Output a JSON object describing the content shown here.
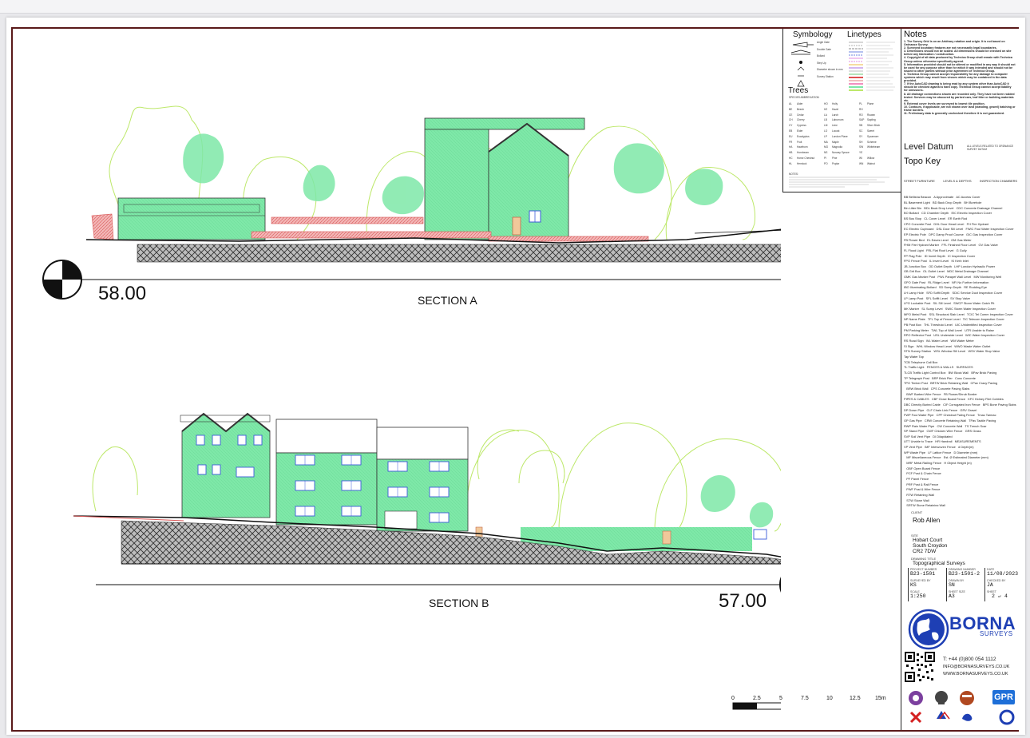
{
  "sheet": {
    "section_a": {
      "title": "SECTION A",
      "level": "58.00"
    },
    "section_b": {
      "title": "SECTION B",
      "level": "57.00"
    }
  },
  "legend": {
    "symbology_title": "Symbology",
    "linetypes_title": "Linetypes",
    "symbology_items": [
      "Angle Gate",
      "Double Gate",
      "Bollard",
      "Step Up",
      "Diameter shown in mm",
      "Survey Station"
    ],
    "trees_title": "Trees",
    "species_abbr": "SPECIES ABBREVIATION",
    "tree_rows": [
      [
        "AL",
        "Alder",
        "HO",
        "Holly",
        "PL",
        "Plane"
      ],
      [
        "BE",
        "Beech",
        "HZ",
        "Hazel",
        "RH",
        ""
      ],
      [
        "CE",
        "Cedar",
        "LA",
        "Larch",
        "RO",
        "Rowan"
      ],
      [
        "CH",
        "Cherry",
        "LB",
        "Laburnum",
        "SAP",
        "Sapling"
      ],
      [
        "CY",
        "Cypress",
        "LM",
        "Lime",
        "SB",
        "Silver Birch"
      ],
      [
        "EB",
        "Elder",
        "LO",
        "Locust",
        "SC",
        "Sweet"
      ],
      [
        "EU",
        "Eucalyptus",
        "LP",
        "London Plane",
        "SY",
        "Sycamore"
      ],
      [
        "FR",
        "Fruit",
        "MA",
        "Maple",
        "SH",
        "Scheme"
      ],
      [
        "HA",
        "Hawthorn",
        "MG",
        "Magnolia",
        "SW",
        "Whitebeam"
      ],
      [
        "HB",
        "Hornbeam",
        "NS",
        "Norway Spruce",
        "YE",
        ""
      ],
      [
        "HC",
        "Horse Chestnut",
        "PI",
        "Pine",
        "WI",
        "Willow"
      ],
      [
        "HL",
        "Hemlock",
        "PO",
        "Poplar",
        "WN",
        "Walnut"
      ]
    ],
    "notes_small": "NOTES:"
  },
  "notes": {
    "title": "Notes",
    "items": [
      "1. The Survey Grid is on an Arbitrary rotation and origin. It is not based on Ordnance Survey.",
      "2. Surveyed boundary features are not necessarily legal boundaries.",
      "3. Dimensions should not be scaled. All dimensions should be checked on site before any fabrication / construction.",
      "4. Copyright of all data produced by Technica Group shall remain with Technica Group unless otherwise specifically agreed.",
      "5. Information provided should not be altered or modified in any way it should not be used for any purpose other than for which it was intended and should not be issued to other parties without prior agreement of Technica Group.",
      "6. Technica Group cannot accept responsibility for any damage to computer systems which may result from viruses which may be contained in the data provided.",
      "7. If the AutoCAD drawing is being read by any system other than AutoCAD it should be checked against a hard copy. Technica Group cannot accept liability for omissions.",
      "8. All drainage connections shown are recorded only. They have not been rodded tested. Services may be obscured by parked cars, leaf litter or building materials etc.",
      "9. External cover levels are surveyed to lowest tile position.",
      "10. Contours, if applicable, are not shown over land (standing, gravel) hatching or frame borders.",
      "11. Preliminary data is generally unchecked therefore it is not guaranteed."
    ]
  },
  "level_datum": {
    "title": "Level Datum",
    "value": "ALL LEVELS RELATED TO ORDNANCE SURVEY DATUM"
  },
  "topo_key": {
    "title": "Topo Key",
    "col_headers": [
      "STREET FURNITURE",
      "LEVELS & DEPTHS",
      "INSPECTION CHAMBERS"
    ],
    "rows": [
      "BB Bellisha Beacon   A Approximate   AC Access Cover",
      "BL Basement Light   BD Back Drop Depth   BH Borehole",
      "Bin Litter Bin   BDL Back Drop Level   CDC Concrete Drainage Channel",
      "BO Bollard   CD Chamber Depth   EIC Electric Inspection Cover",
      "BS Bus Stop   CL Cover Level   ER Earth Rod",
      "CPO Concrete Post   DHL Door Head Level   FH Fire Hydrant",
      "EC Electric Cupboard   DSL Door Sill Level   FWIC Foul Water Inspection Cover",
      "EP Electric Pole   DPC Damp Proof Course   GIC Gas Inspection Cover",
      "FB Flower Bed   EL Eaves Level   GM Gas Meter",
      "FHM Fire Hydrant Marker   FFL Finished Floor Level   GV Gas Valve",
      "FL Flood Light   FRL Flat Roof Level   G Gully",
      "FP Flag Pole   ID Invert Depth   IC Inspection Cover",
      "FPO Fence Post   IL Invert Level   KI Kerb Inlet",
      "JB Junction Box   OD Outlet Depth   LHP London Hydraulic Power",
      "GB Grit Box   OL Outlet Level   MDC Metal Drainage Channel",
      "GMK Gas Marker Post   PWL Parapet Wall Level   MW Monitoring Well",
      "GPO Gate Post   RL Ridge Level   NFI No Further Information",
      "IBO Illuminating Bollard   SD Sump Depth   RE Rodding Eye",
      "LH Lamp Hole   SFD Soffit Depth   SDIC Service Duct Inspection Cover",
      "LP Lamp Post   SFL Soffit Level   SV Stop Valve",
      "LPO Lockable Post   SIL Sill Level   SWCP Storm Water Catch Pit",
      "MK Marker   SL Sump Level   SWIC Storm Water Inspection Cover",
      "MPO Metal Post   SSL Structural Slab Level   TCIC Tel Comm Inspection Cover",
      "NP Name Plate   TFL Top of Fence Level   TIC Telecom Inspection Cover",
      "PB Post Box   THL Threshold Level   UIC Unidentified Inspection Cover",
      "PM Parking Meter   TWL Top of Wall Level   UTR Unable to Raise",
      "RPO Reflector Post   USL Underside Level   WIC Water Inspection Cover",
      "RS Road Sign   WL Water Level   WM Water Meter",
      "SI Sign   WHL Window Head Level   WWO Waste Water Outlet",
      "STN Survey Station   WSL Window Sill Level   WSV Water Stop Valve",
      "Tap Water Tap",
      "TCB Telephone Call Box",
      "TL Traffic Light   FENCES & WALLS   SURFACES",
      "TLCB Traffic Light Control Box   BW Block Wall   BPav Brick Paving",
      "TP Telegraph Post   BRP Brick Pier   Conc Concrete",
      "TPO Timber Post   BRTW Brick Retaining Wall   CPav Crazy Paving",
      "   BRW Brick Wall   CPS Concrete Paving Slabs",
      "   BWF Barbed Wire Fence   FB Flower/Shrub Border",
      "PIPES & CABLES   CBF Close Board Fence   KFC Kidney Flint Cobbles",
      "DBC Directly Buried Cable   CIF Corrugated Iron Fence   BPS Bone Paving Slabs",
      "DP Down Pipe   CLF Chain Link Fence   GRV Gravel",
      "FWP Foul Water Pipe   CPF Chestnut Paling Fence   Tmac Tarmac",
      "GP Gas Pipe   CRW Concrete Retaining Wall   TPav Tactile Paving",
      "RWP Rain Water Pipe   CW Concrete Wall   TS Trench Scar",
      "SP Stand Pipe   CWF Chicken Wire Fence   GRS Grass",
      "SVP Soil Vent Pipe   DI Dilapidated",
      "UTT Unable to Trace   HR Handrail   MEASUREMENTS",
      "VP Vent Pipe   IMF Interwoven Fence   d Depth(m)",
      "WP Waste Pipe   LF Lattice Fence   D Diameter (mm)",
      "   MF Miscellaneous Fence   Est. Ø Estimated Diameter (mm)",
      "   MRF Metal Railing Fence   H Object Height (m)",
      "   OBF Open Board Fence",
      "   PCF Post & Chain Fence",
      "   PF Panel Fence",
      "   PRF Post & Rail Fence",
      "   PWF Post & Wire Fence",
      "   RTW Retaining Wall",
      "   STW Stone Wall",
      "   SRTW Stone Retaining Wall",
      "   WMF Wire Mesh Fence"
    ]
  },
  "title_block": {
    "client_label": "CLIENT",
    "client": "Rob Allen",
    "site_label": "SITE",
    "site_lines": [
      "Hobart Court",
      "South Croydon",
      "CR2 7DW"
    ],
    "drawing_title_label": "DRAWING TITLE",
    "drawing_title": "Topographical Surveys",
    "fields": [
      {
        "label": "PROJECT NUMBER",
        "value": "B23-1501"
      },
      {
        "label": "DRAWING NUMBER",
        "value": "B23-1501-2"
      },
      {
        "label": "DATE",
        "value": "11/08/2023"
      },
      {
        "label": "SURVEYED BY",
        "value": "KS"
      },
      {
        "label": "DRAWN BY",
        "value": "SN"
      },
      {
        "label": "CHECKED BY",
        "value": "JA"
      },
      {
        "label": "SCALE",
        "value": "1:250"
      },
      {
        "label": "SHEET SIZE",
        "value": "A3"
      },
      {
        "label": "SHEET",
        "value": "2"
      }
    ],
    "sheet_of": "of",
    "sheet_total": "4"
  },
  "company": {
    "name": "BORNA",
    "sub": "SURVEYS",
    "phone": "T: +44 (0)800 054 1112",
    "email": "INFO@BORNASURVEYS.CO.UK",
    "web": "WWW.BORNASURVEYS.CO.UK",
    "logo_gpr": "GPR"
  },
  "scale_bar": {
    "ticks": [
      "0",
      "2.5",
      "5",
      "7.5",
      "10",
      "12.5",
      "15m"
    ]
  },
  "colors": {
    "building": "#7ee8a8",
    "tree_outline": "#bde86a",
    "wall": "#e07070",
    "frame": "#5a1a1a",
    "brand": "#1e3fb4"
  }
}
